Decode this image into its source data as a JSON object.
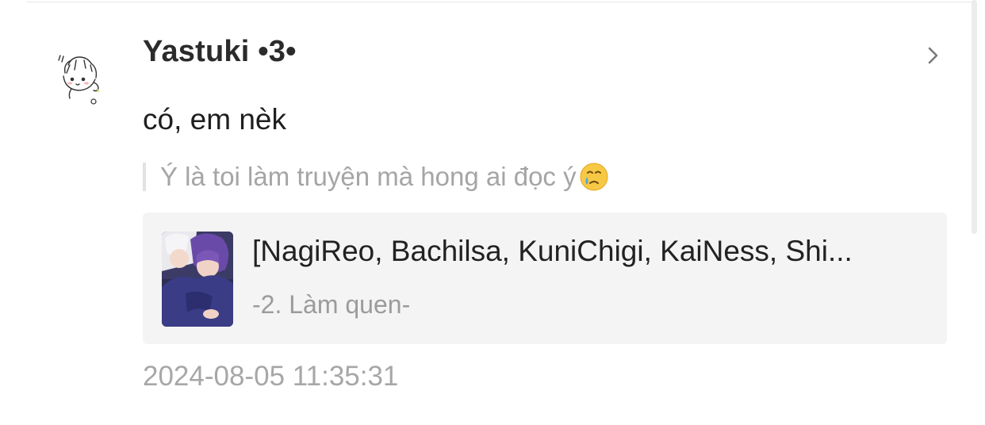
{
  "comment": {
    "username": "Yastuki •3•",
    "text": "có, em nèk",
    "quoted_text": "Ý là toi làm truyện mà hong ai đọc ý",
    "quoted_emoji": "face-holding-back-tears-emoji",
    "timestamp": "2024-08-05 11:35:31"
  },
  "story": {
    "title": "[NagiReo, Bachilsa, KuniChigi, KaiNess, Shi...",
    "chapter": "-2. Làm quen-"
  },
  "icons": {
    "avatar": "sketch-avatar",
    "chevron": "chevron-right-icon"
  },
  "colors": {
    "card_background": "#f4f4f4",
    "muted_text": "#a5a5a5",
    "primary_text": "#222222"
  }
}
